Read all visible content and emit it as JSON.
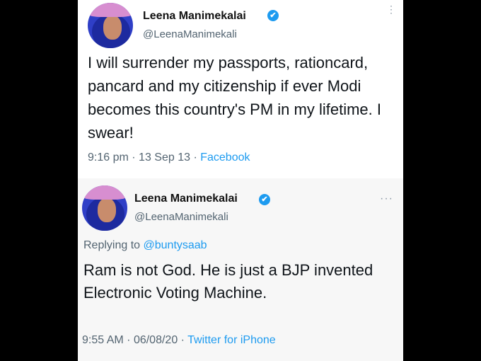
{
  "tweets": [
    {
      "name": "Leena Manimekalai",
      "handle": "@LeenaManimekali",
      "text": "I will surrender my passports, rationcard, pancard and my citizenship if ever Modi becomes this country's PM in my lifetime. I swear!",
      "time": "9:16 pm",
      "date": "13 Sep 13",
      "separator": "·",
      "source": "Facebook",
      "verified_icon": "✔",
      "more_icon": "⋮"
    },
    {
      "name": "Leena Manimekalai",
      "handle": "@LeenaManimekali",
      "replying_prefix": "Replying to",
      "replying_to": "@buntysaab",
      "text": "Ram is not God. He is just a BJP invented Electronic Voting Machine.",
      "time": "9:55 AM",
      "date": "06/08/20",
      "separator": "·",
      "source": "Twitter for iPhone",
      "verified_icon": "✔",
      "more_icon": "···"
    }
  ],
  "colors": {
    "background": "#000000",
    "card": "#ffffff",
    "link": "#1d9bf0",
    "muted": "#536471",
    "verified": "#1d9bf0"
  }
}
